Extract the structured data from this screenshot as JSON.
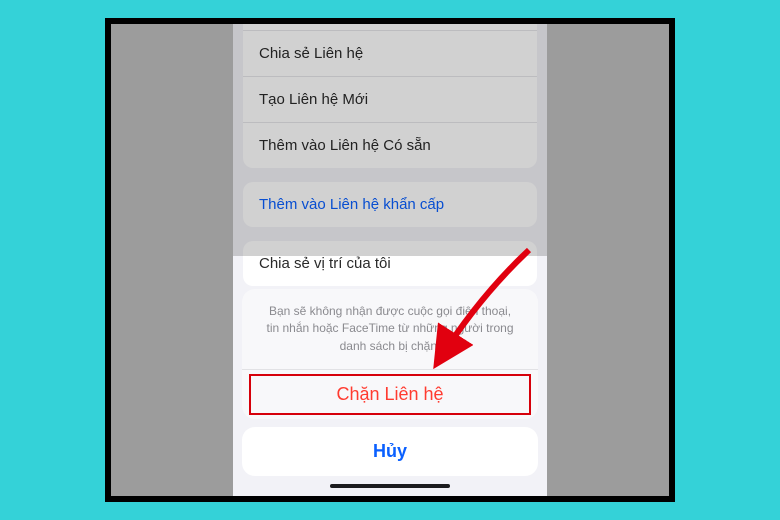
{
  "background_list": {
    "group1": {
      "row_top_partial": "",
      "share_contact": "Chia sẻ Liên hệ",
      "create_new": "Tạo Liên hệ Mới",
      "add_existing": "Thêm vào Liên hệ Có sẵn"
    },
    "group2": {
      "emergency": "Thêm vào Liên hệ khẩn cấp"
    },
    "group3": {
      "share_location": "Chia sẻ vị trí của tôi"
    }
  },
  "action_sheet": {
    "message": "Bạn sẽ không nhận được cuộc gọi điện thoại, tin nhắn hoặc FaceTime từ những người trong danh sách bị chặn.",
    "destructive": "Chặn Liên hệ",
    "cancel": "Hủy"
  },
  "annotation": {
    "arrow_color": "#e1000f"
  }
}
